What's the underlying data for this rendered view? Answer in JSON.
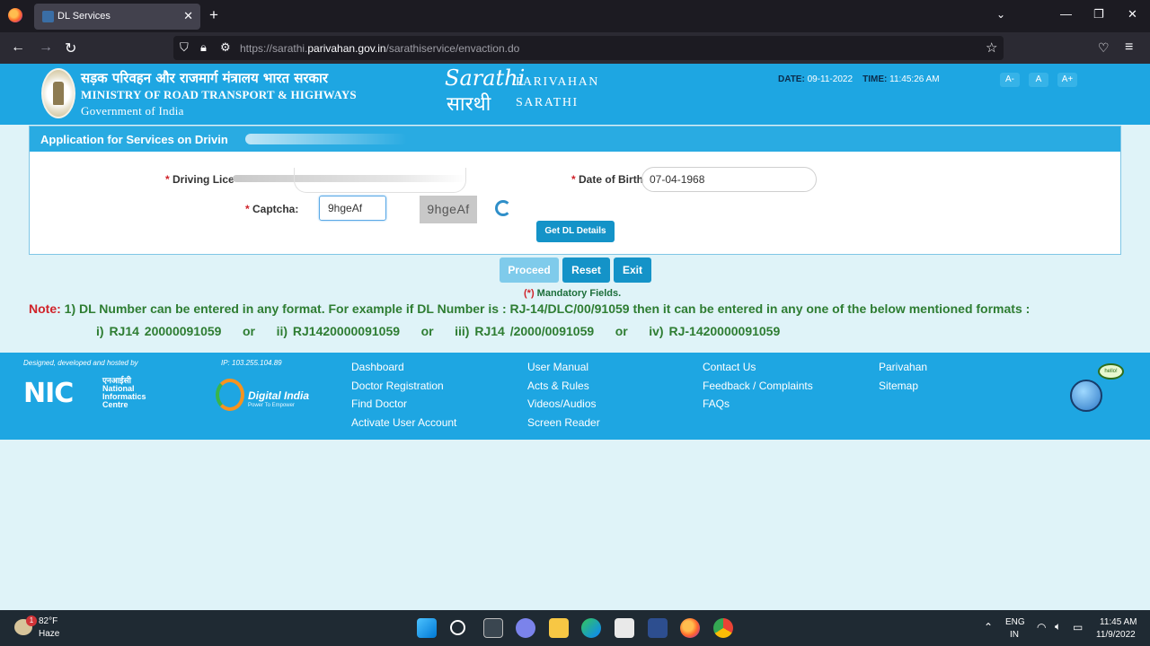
{
  "browser": {
    "tab_title": "DL Services",
    "tab_close": "✕",
    "new_tab": "+",
    "list_all_tabs": "⌄",
    "win_min": "—",
    "win_max": "❐",
    "win_close": "✕",
    "back": "←",
    "forward": "→",
    "reload": "↻",
    "url_prefix": "https://sarathi.",
    "url_host": "parivahan.gov.in",
    "url_path": "/sarathiservice/envaction.do",
    "bookmark": "☆",
    "pocket": "♡",
    "menu": "≡"
  },
  "header": {
    "ministry_hindi": "सड़क परिवहन और राजमार्ग मंत्रालय भारत सरकार",
    "ministry_name": "MINISTRY OF ROAD TRANSPORT & HIGHWAYS",
    "government": "Government of India",
    "logo_top": "Sarathi",
    "logo_bottom": "सारथी",
    "parivahan": "PARIVAHAN",
    "sarathi": "SARATHI",
    "date_label": "DATE:",
    "date_value": "09-11-2022",
    "time_label": "TIME:",
    "time_value": "11:45:26 AM",
    "font_decrease": "A-",
    "font_normal": "A",
    "font_increase": "A+"
  },
  "form": {
    "title": "Application for Services on Drivin",
    "dl_label": "Driving Lice",
    "dob_label": "Date of Birth",
    "dob_value": "07-04-1968",
    "captcha_label": "Captcha:",
    "captcha_value": "9hgeAf",
    "captcha_image_text": "9hgeAf",
    "get_dl_button": "Get DL Details",
    "required_mark": "*"
  },
  "actions": {
    "proceed": "Proceed",
    "reset": "Reset",
    "exit": "Exit",
    "mandatory_mark": "(*)",
    "mandatory_text": "Mandatory Fields."
  },
  "note": {
    "label": "Note:",
    "text": "1) DL Number can be entered in any format. For example if DL Number is : RJ-14/DLC/00/91059 then it can be entered in any one of the below mentioned formats :",
    "formats": "i) RJ14 20000091059    or    ii) RJ1420000091059    or    iii) RJ14 /2000/0091059    or    iv) RJ-1420000091059"
  },
  "footer": {
    "designed_by": "Designed, developed and hosted by",
    "ip": "IP: 103.255.104.89",
    "nic": "NIC",
    "nic_hindi": "एनआईसी",
    "nic_line1": "National",
    "nic_line2": "Informatics",
    "nic_line3": "Centre",
    "digital_india": "Digital India",
    "digital_india_sub": "Power To Empower",
    "links_col1": [
      "Dashboard",
      "Doctor Registration",
      "Find Doctor",
      "Activate User Account"
    ],
    "links_col2": [
      "User Manual",
      "Acts & Rules",
      "Videos/Audios",
      "Screen Reader"
    ],
    "links_col3": [
      "Contact Us",
      "Feedback / Complaints",
      "FAQs"
    ],
    "links_col4": [
      "Parivahan",
      "Sitemap"
    ],
    "mascot_bubble": "hello!"
  },
  "taskbar": {
    "weather_badge": "1",
    "temp": "82°F",
    "condition": "Haze",
    "lang_line1": "ENG",
    "lang_line2": "IN",
    "time": "11:45 AM",
    "date": "11/9/2022"
  },
  "colors": {
    "header_blue": "#1ea6e2",
    "panel_blue": "#29abe2",
    "note_green": "#2e7d32",
    "required_red": "#d0232a",
    "page_bg": "#dff3f8"
  }
}
